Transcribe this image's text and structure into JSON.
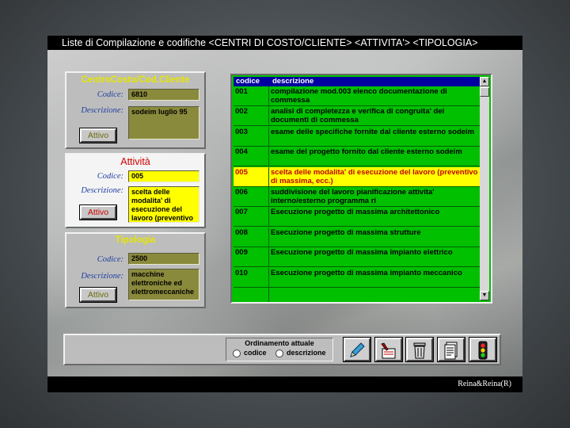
{
  "window": {
    "title": "Liste di Compilazione e codifiche <CENTRI DI COSTO/CLIENTE> <ATTIVITA'> <TIPOLOGIA>",
    "credit": "Reina&Reina(R)"
  },
  "colors": {
    "grid_bg": "#00c000",
    "grid_header": "#0000a0",
    "highlight_yellow": "#ffff00",
    "olive_field": "#8a8a3c",
    "panel_title_yellow": "#e6e600",
    "panel_title_red": "#d00000"
  },
  "panels": [
    {
      "title": "CentroCosto/Cod.Cliente",
      "code_label": "Codice:",
      "code_value": "6810",
      "desc_label": "Descrizione:",
      "desc_value": "sodeim luglio 95",
      "button": "Attivo"
    },
    {
      "title": "Attività",
      "code_label": "Codice:",
      "code_value": "005",
      "desc_label": "Descrizione:",
      "desc_value": "scelta delle modalita' di esecuzione del lavoro (preventivo di massima, ecc.)",
      "button": "Attivo"
    },
    {
      "title": "Tipologia",
      "code_label": "Codice:",
      "code_value": "2500",
      "desc_label": "Descrizione:",
      "desc_value": "macchine elettroniche ed elettromeccaniche",
      "button": "Attivo"
    }
  ],
  "grid": {
    "columns": [
      "codice",
      "descrizione"
    ],
    "selected_index": 4,
    "rows": [
      {
        "code": "001",
        "desc": "compilazione mod.003 elenco documentazione di commessa"
      },
      {
        "code": "002",
        "desc": "analisi di completezza e verifica di congruita' dei documenti di commessa"
      },
      {
        "code": "003",
        "desc": "esame delle specifiche fornite dal cliente esterno sodeim"
      },
      {
        "code": "004",
        "desc": "esame del progetto fornito dal cliente esterno sodeim"
      },
      {
        "code": "005",
        "desc": "scelta delle modalita' di esecuzione del lavoro (preventivo di massima, ecc.)"
      },
      {
        "code": "006",
        "desc": " suddivisione del lavoro   pianificazione attivita' interno/esterno programma ri"
      },
      {
        "code": "007",
        "desc": "Esecuzione progetto di massima architettonico"
      },
      {
        "code": "008",
        "desc": "Esecuzione progetto di massima strutture"
      },
      {
        "code": "009",
        "desc": "Esecuzione progetto di massima impianto elettrico"
      },
      {
        "code": "010",
        "desc": "Esecuzione progetto di massima impianto meccanico"
      },
      {
        "code": "",
        "desc": ""
      }
    ]
  },
  "ordering": {
    "title": "Ordinamento attuale",
    "options": [
      "codice",
      "descrizione"
    ]
  },
  "tools": [
    {
      "icon": "pen-icon"
    },
    {
      "icon": "edit-form-icon"
    },
    {
      "icon": "trash-icon"
    },
    {
      "icon": "print-icon"
    },
    {
      "icon": "traffic-light-icon"
    }
  ]
}
